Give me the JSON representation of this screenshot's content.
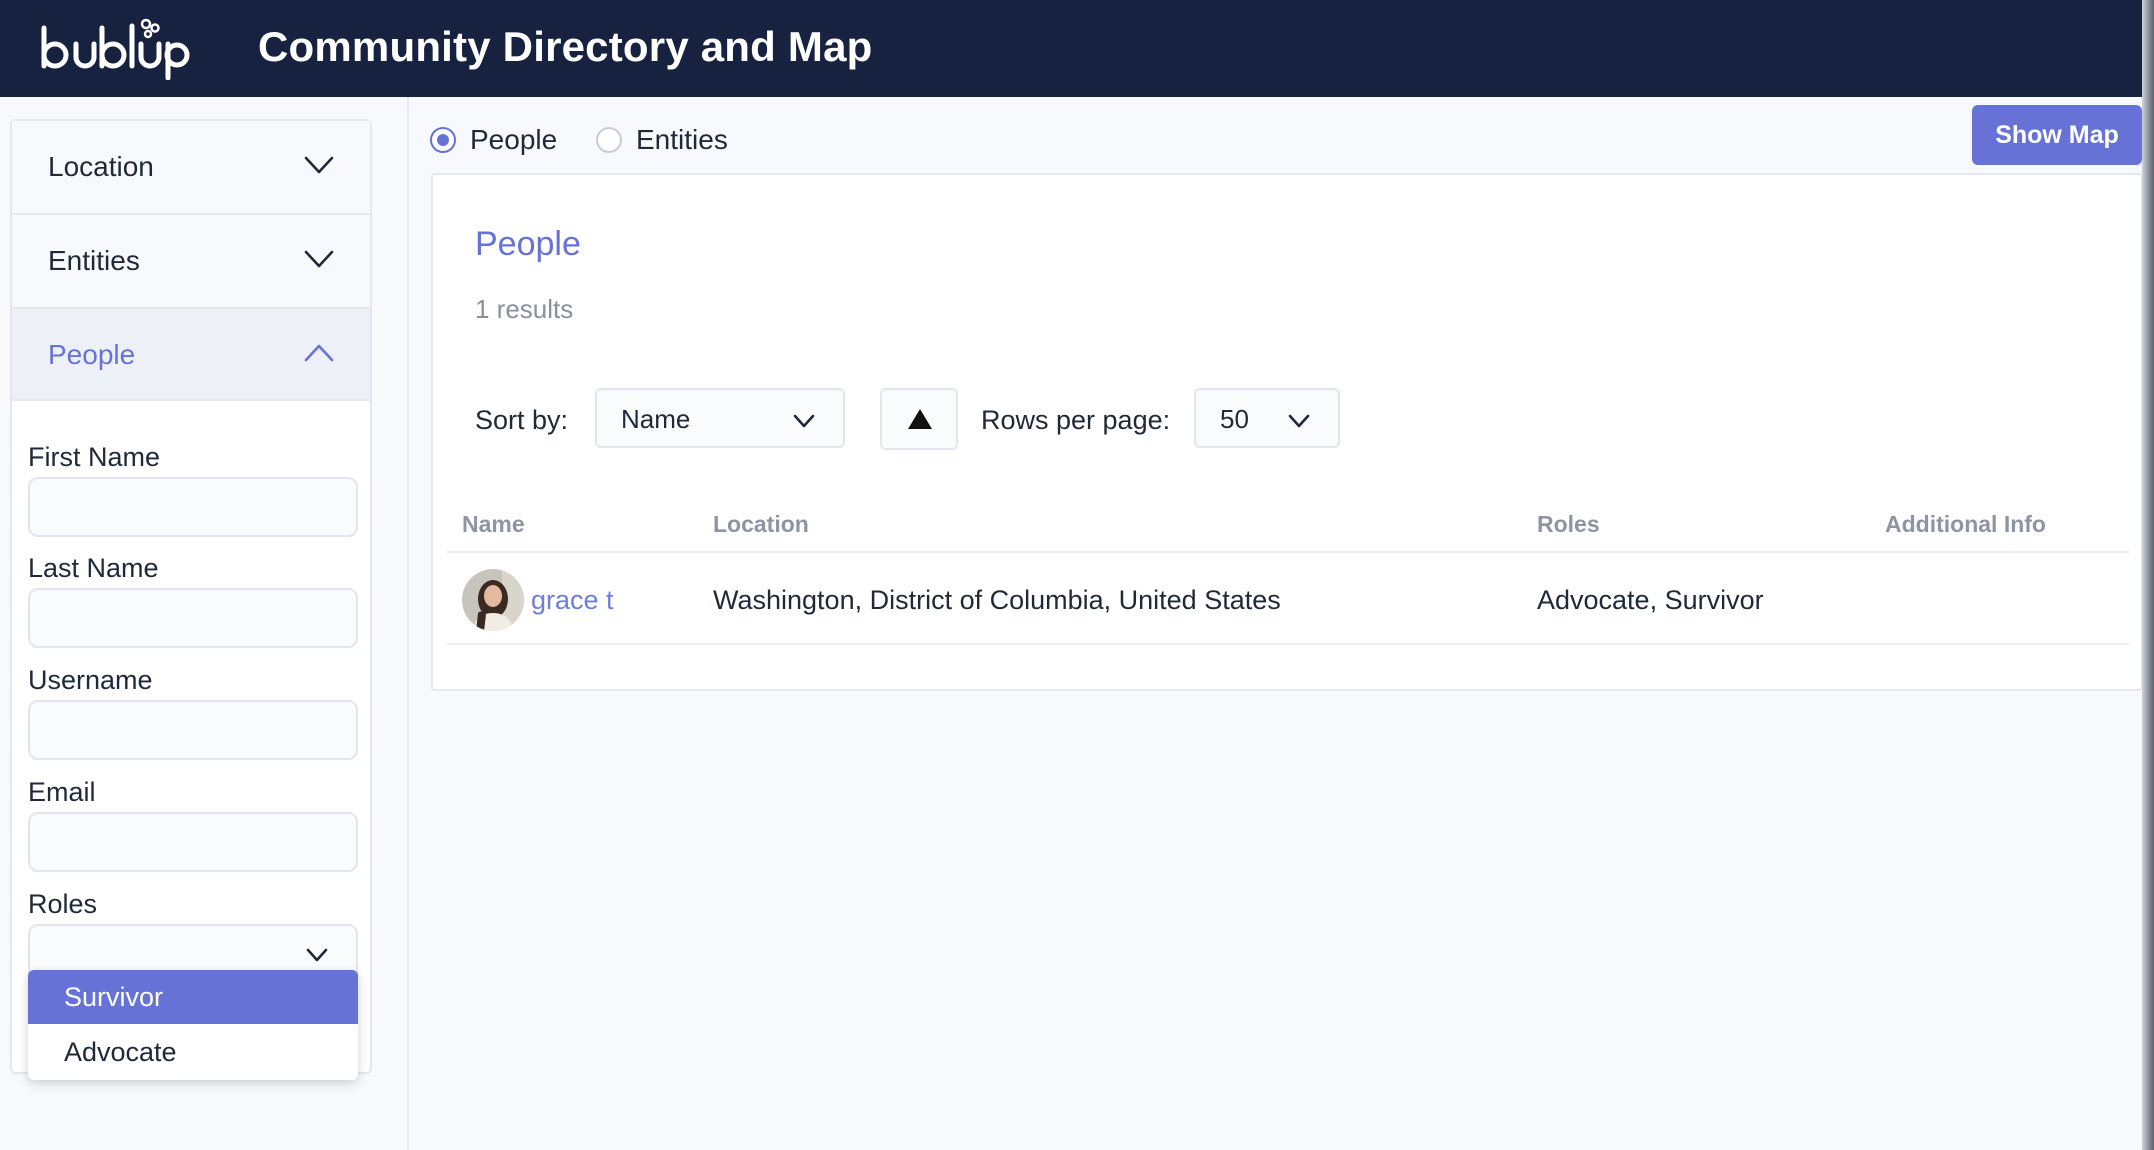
{
  "header": {
    "logo_text": "bublup",
    "title": "Community Directory and Map"
  },
  "sidebar": {
    "sections": [
      {
        "label": "Location",
        "expanded": false,
        "icon": "chevron-down-icon"
      },
      {
        "label": "Entities",
        "expanded": false,
        "icon": "chevron-down-icon"
      },
      {
        "label": "People",
        "expanded": true,
        "icon": "chevron-up-icon"
      }
    ],
    "fields": {
      "first_name": {
        "label": "First Name",
        "value": "",
        "placeholder": ""
      },
      "last_name": {
        "label": "Last Name",
        "value": "",
        "placeholder": ""
      },
      "username": {
        "label": "Username",
        "value": "",
        "placeholder": ""
      },
      "email": {
        "label": "Email",
        "value": "",
        "placeholder": ""
      },
      "roles": {
        "label": "Roles",
        "value": ""
      }
    },
    "roles_dropdown": {
      "open": true,
      "options": [
        {
          "label": "Survivor",
          "highlighted": true
        },
        {
          "label": "Advocate",
          "highlighted": false
        }
      ]
    }
  },
  "main": {
    "view_toggle": [
      {
        "label": "People",
        "checked": true
      },
      {
        "label": "Entities",
        "checked": false
      }
    ],
    "show_map_label": "Show Map",
    "card": {
      "title": "People",
      "count": "1 results",
      "sort_label": "Sort by:",
      "sort_value": "Name",
      "sort_direction": "ascending",
      "rows_label": "Rows per page:",
      "rows_value": "50"
    },
    "table": {
      "columns": [
        "Name",
        "Location",
        "Roles",
        "Additional Info"
      ],
      "rows": [
        {
          "name": "grace t",
          "location": "Washington, District of Columbia, United States",
          "roles": "Advocate, Survivor",
          "additional_info": ""
        }
      ]
    }
  },
  "colors": {
    "header_bg": "#172240",
    "accent": "#6672d6",
    "link": "#6d7fd8",
    "page_bg": "#f8f9fc",
    "muted_text": "#8e94a3"
  }
}
